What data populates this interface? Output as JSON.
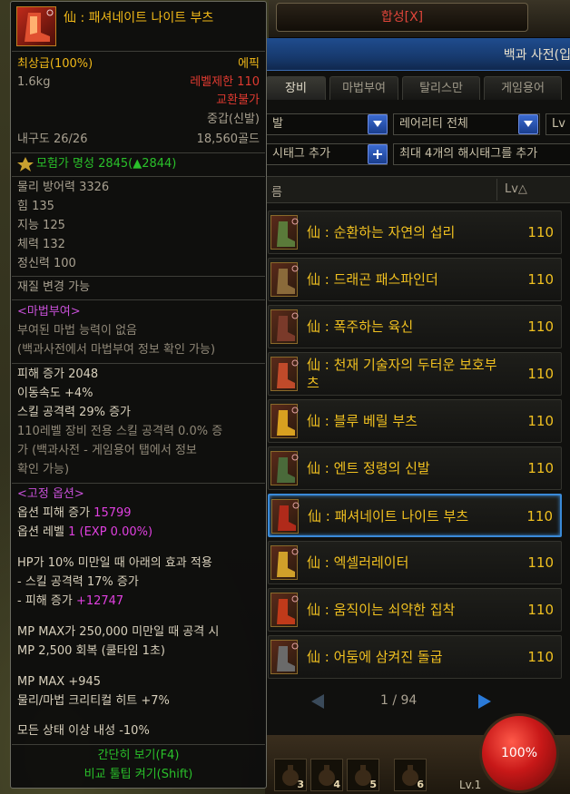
{
  "craft": {
    "tab_label": "합성[X]"
  },
  "encyclopedia": {
    "title": "백과 사전(입",
    "tabs": [
      {
        "label": "장비",
        "active": true
      },
      {
        "label": "마법부여",
        "active": false
      },
      {
        "label": "탈리스만",
        "active": false
      },
      {
        "label": "게임용어",
        "active": false
      }
    ],
    "filters": {
      "type_partial": "발",
      "rarity": "레어리티 전체",
      "level_partial": "Lv"
    },
    "hashtag": {
      "add_partial": "시태그 추가",
      "placeholder": "최대 4개의 해시태그를 추가"
    },
    "list_header": {
      "name_partial": "름",
      "level": "Lv△"
    },
    "items": [
      {
        "name": "仙 : 순환하는 자연의 섭리",
        "level": "110",
        "selected": false
      },
      {
        "name": "仙 : 드래곤 패스파인더",
        "level": "110",
        "selected": false
      },
      {
        "name": "仙 : 폭주하는 육신",
        "level": "110",
        "selected": false
      },
      {
        "name": "仙 : 천재 기술자의 두터운 보호부츠",
        "level": "110",
        "selected": false
      },
      {
        "name": "仙 : 블루 베릴 부츠",
        "level": "110",
        "selected": false
      },
      {
        "name": "仙 : 엔트 정령의 신발",
        "level": "110",
        "selected": false
      },
      {
        "name": "仙 : 패셔네이트 나이트 부츠",
        "level": "110",
        "selected": true
      },
      {
        "name": "仙 : 엑셀러레이터",
        "level": "110",
        "selected": false
      },
      {
        "name": "仙 : 움직이는 쇠약한 집착",
        "level": "110",
        "selected": false
      },
      {
        "name": "仙 : 어둠에 삼켜진 돌굽",
        "level": "110",
        "selected": false
      }
    ],
    "pagination": {
      "text": "1 / 94"
    }
  },
  "bottom": {
    "slots": [
      "3",
      "4",
      "5",
      "6"
    ],
    "level_label": "Lv.1",
    "hp_text": "100%"
  },
  "tooltip": {
    "item_name": "仙 : 패셔네이트 나이트 부츠",
    "grade": "최상급(100%)",
    "rarity": "에픽",
    "weight": "1.6kg",
    "level_limit": "레벨제한 110",
    "trade": "교환불가",
    "armor_type": "중갑(신발)",
    "durability": "내구도 26/26",
    "price": "18,560골드",
    "fame": "모험가 명성 2845(▲2844)",
    "base_stats": [
      "물리 방어력 3326",
      "힘 135",
      "지능 125",
      "체력 132",
      "정신력 100"
    ],
    "material_change": "재질 변경 가능",
    "enchant": {
      "header": "<마법부여>",
      "lines": [
        "부여된 마법 능력이 없음",
        "(백과사전에서 마법부여 정보 확인 가능)"
      ]
    },
    "bonus": {
      "lines": [
        "피해 증가 2048",
        "이동속도 +4%",
        "스킬 공격력 29% 증가"
      ],
      "skill_note": [
        "110레벨 장비 전용 스킬 공격력 0.0% 증",
        "가 (백과사전 - 게임용어 탭에서 정보",
        "확인 가능)"
      ]
    },
    "fixed": {
      "header": "<고정 옵션>",
      "damage_label": "옵션 피해 증가 ",
      "damage_value": "15799",
      "level_label": "옵션 레벨 ",
      "level_value": "1 (EXP 0.00%)"
    },
    "hp_effect": {
      "condition": "HP가 10% 미만일 때 아래의 효과 적용",
      "skill": "- 스킬 공격력 17% 증가",
      "damage_label": "- 피해 증가 ",
      "damage_value": "+12747"
    },
    "mp_effect": [
      "MP MAX가 250,000 미만일 때 공격 시",
      "MP 2,500 회복 (쿨타임 1초)"
    ],
    "extra": [
      "MP MAX +945",
      "물리/마법 크리티컬 히트 +7%"
    ],
    "resist": "모든 상태 이상 내성 -10%",
    "footer": [
      "간단히 보기(F4)",
      "비교 툴팁 켜기(Shift)"
    ]
  },
  "colors": {
    "epic": "#f0b818",
    "warning": "#e03a30",
    "fame": "#2ac02a",
    "option_value": "#e040e0",
    "selection": "#3a8ad8"
  }
}
